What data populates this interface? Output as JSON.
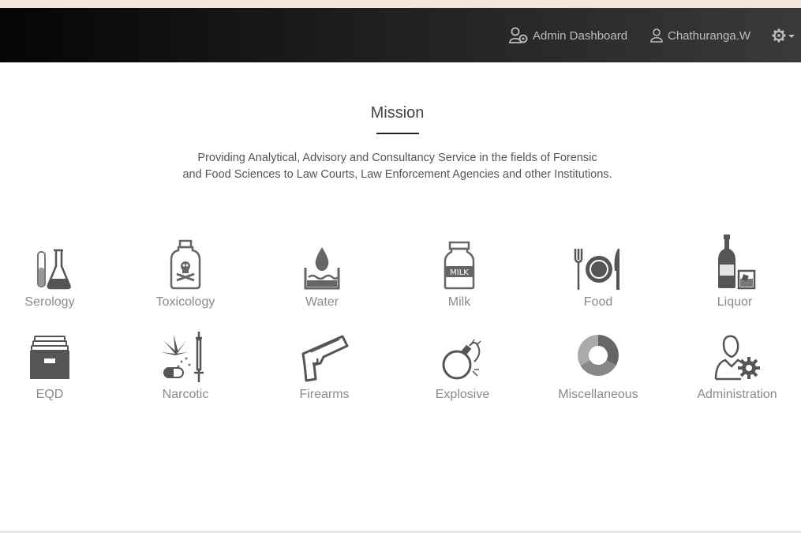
{
  "navbar": {
    "admin_dashboard": "Admin Dashboard",
    "username": "Chathuranga.W",
    "icons": [
      "admin-user-icon",
      "user-icon",
      "gear-icon",
      "caret-down-icon"
    ]
  },
  "mission": {
    "title": "Mission",
    "line1": "Providing Analytical, Advisory and Consultancy Service in the fields of Forensic",
    "line2": "and Food Sciences to Law Courts, Law Enforcement Agencies and other Institutions."
  },
  "categories": [
    {
      "label": "Serology",
      "icon": "test-tube-flask-icon"
    },
    {
      "label": "Toxicology",
      "icon": "poison-bottle-icon"
    },
    {
      "label": "Water",
      "icon": "water-drop-icon"
    },
    {
      "label": "Milk",
      "icon": "milk-bottle-icon"
    },
    {
      "label": "Food",
      "icon": "plate-cutlery-icon"
    },
    {
      "label": "Liquor",
      "icon": "bottle-glass-icon"
    },
    {
      "label": "EQD",
      "icon": "file-drawer-icon"
    },
    {
      "label": "Narcotic",
      "icon": "cannabis-syringe-icon"
    },
    {
      "label": "Firearms",
      "icon": "pistol-icon"
    },
    {
      "label": "Explosive",
      "icon": "bomb-icon"
    },
    {
      "label": "Miscellaneous",
      "icon": "donut-chart-icon"
    },
    {
      "label": "Administration",
      "icon": "admin-gear-icon"
    }
  ],
  "colors": {
    "navbar_start": "#050505",
    "navbar_end": "#3a3a3a",
    "icon_gray": "#666666",
    "label_gray": "#8a8a8a"
  }
}
